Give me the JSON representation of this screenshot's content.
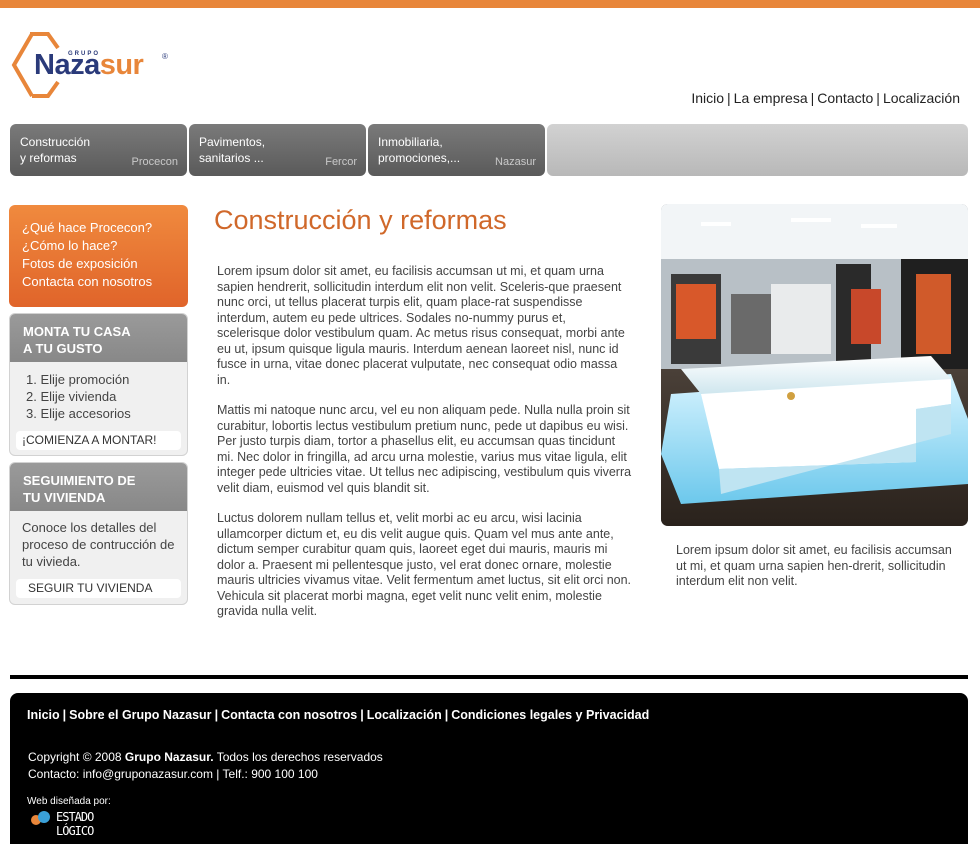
{
  "logo": {
    "grupo": "GRUPO",
    "brand_a": "Naza",
    "brand_b": "sur",
    "reg": "®"
  },
  "topnav": [
    "Inicio",
    "La empresa",
    "Contacto",
    "Localización"
  ],
  "tabs": [
    {
      "line1": "Construcción",
      "line2": "y reformas",
      "company": "Procecon"
    },
    {
      "line1": "Pavimentos,",
      "line2": "sanitarios ...",
      "company": "Fercor"
    },
    {
      "line1": "Inmobiliaria,",
      "line2": "promociones,...",
      "company": "Nazasur"
    }
  ],
  "sidebar": {
    "links": [
      "¿Qué hace Procecon?",
      "¿Cómo lo hace?",
      "Fotos de exposición",
      "Contacta con nosotros"
    ],
    "box1": {
      "title_l1": "MONTA TU CASA",
      "title_l2": "A TU GUSTO",
      "steps": [
        "1. Elije promoción",
        "2. Elije vivienda",
        "3. Elije accesorios"
      ],
      "button": "¡COMIENZA A MONTAR!"
    },
    "box2": {
      "title_l1": "SEGUIMIENTO DE",
      "title_l2": "TU VIVIENDA",
      "text": "Conoce los detalles del proceso de contrucción de tu vivieda.",
      "button": "SEGUIR TU VIVIENDA"
    }
  },
  "main": {
    "title": "Construcción y reformas",
    "paragraphs": [
      "Lorem ipsum dolor sit amet, eu facilisis accumsan ut mi, et quam urna sapien hendrerit, sollicitudin interdum elit non velit. Sceleris-que praesent nunc orci, ut tellus placerat turpis elit, quam place-rat suspendisse interdum, autem eu pede ultrices. Sodales no-nummy purus et, scelerisque dolor vestibulum quam. Ac metus risus consequat, morbi ante eu ut, ipsum quisque ligula mauris. Interdum aenean laoreet nisl, nunc id fusce in urna, vitae donec placerat vulputate, nec consequat odio massa in.",
      "Mattis mi natoque nunc arcu, vel eu non aliquam pede. Nulla nulla proin sit curabitur, lobortis lectus vestibulum pretium nunc, pede ut dapibus eu wisi. Per justo turpis diam, tortor a phasellus elit, eu accumsan quas tincidunt mi. Nec dolor in fringilla, ad arcu urna molestie, varius mus vitae ligula, elit integer pede ultricies vitae. Ut tellus nec adipiscing, vestibulum quis viverra velit diam, euismod vel quis blandit sit.",
      "Luctus dolorem nullam tellus et, velit morbi ac eu arcu, wisi lacinia ullamcorper dictum et, eu dis velit augue quis. Quam vel mus ante ante, dictum semper curabitur quam quis, laoreet eget dui mauris, mauris mi dolor a. Praesent mi pellentesque justo, vel erat donec ornare, molestie mauris ultricies vivamus vitae. Velit fermentum amet luctus, sit elit orci non. Vehicula sit placerat morbi magna, eget velit nunc velit enim, molestie gravida nulla velit."
    ],
    "caption": "Lorem ipsum dolor sit amet, eu facilisis accumsan ut mi, et quam urna sapien hen-drerit, sollicitudin interdum elit non velit."
  },
  "footer": {
    "nav": [
      "Inicio",
      "Sobre el Grupo Nazasur",
      "Contacta con nosotros",
      "Localización",
      "Condiciones legales y Privacidad"
    ],
    "copyright_pre": "Copyright © 2008 ",
    "copyright_brand": "Grupo Nazasur.",
    "copyright_post": " Todos los derechos reservados",
    "contact": "Contacto: info@gruponazasur.com | Telf.: 900 100 100",
    "credit": "Web diseñada por:",
    "designer": "ESTADO LÓGICO"
  },
  "colors": {
    "accent": "#e8863a",
    "brand_blue": "#2a3a7a",
    "title_orange": "#d0682a"
  }
}
